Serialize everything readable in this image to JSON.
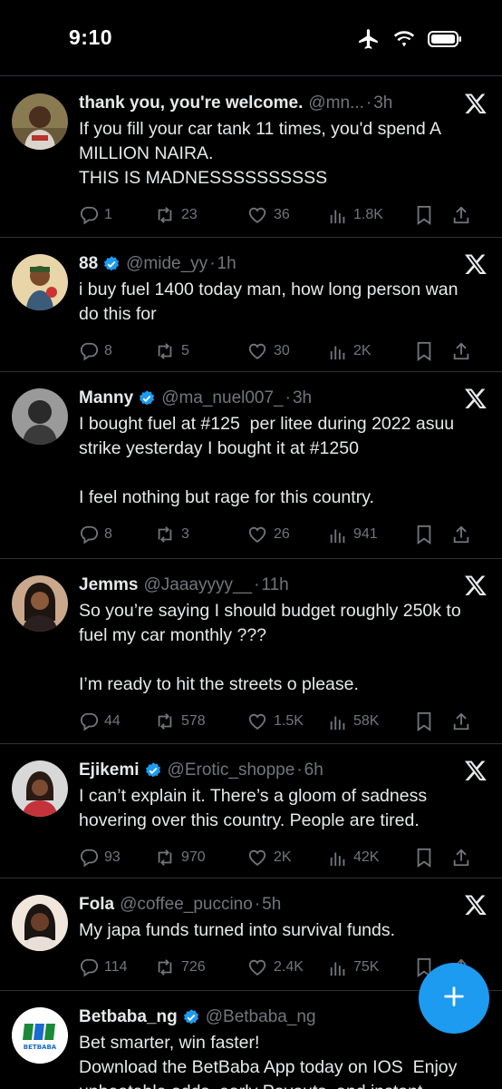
{
  "status_bar": {
    "time": "9:10",
    "icons": [
      "airplane-icon",
      "wifi-icon",
      "battery-icon"
    ]
  },
  "colors": {
    "accent": "#1d9bf0",
    "muted": "#71767b",
    "text": "#e7e9ea",
    "background": "#000000",
    "divider": "#2f3336"
  },
  "tweets": [
    {
      "name": "thank you, you're welcome.",
      "verified": false,
      "handle": "@mn...",
      "time": "3h",
      "text": "If you fill your car tank 11 times, you'd spend A MILLION NAIRA.\nTHIS IS MADNESSSSSSSSSS",
      "replies": "1",
      "retweets": "23",
      "likes": "36",
      "views": "1.8K"
    },
    {
      "name": "88",
      "verified": true,
      "handle": "@mide_yy",
      "time": "1h",
      "text": "i buy fuel 1400 today man, how long person wan do this for",
      "replies": "8",
      "retweets": "5",
      "likes": "30",
      "views": "2K"
    },
    {
      "name": "Manny",
      "verified": true,
      "handle": "@ma_nuel007_",
      "time": "3h",
      "text": "I bought fuel at #125  per litee during 2022 asuu strike yesterday I bought it at #1250\n\nI feel nothing but rage for this country.",
      "replies": "8",
      "retweets": "3",
      "likes": "26",
      "views": "941"
    },
    {
      "name": "Jemms",
      "verified": false,
      "handle": "@Jaaayyyy__",
      "time": "11h",
      "text": "So you’re saying I should budget roughly 250k to fuel my car monthly ???\n\nI’m ready to hit the streets o please.",
      "replies": "44",
      "retweets": "578",
      "likes": "1.5K",
      "views": "58K"
    },
    {
      "name": "Ejikemi",
      "verified": true,
      "handle": "@Erotic_shoppe",
      "time": "6h",
      "text": "I can’t explain it. There’s a gloom of sadness hovering over this country. People are tired.",
      "replies": "93",
      "retweets": "970",
      "likes": "2K",
      "views": "42K"
    },
    {
      "name": "Fola",
      "verified": false,
      "handle": "@coffee_puccino",
      "time": "5h",
      "text": "My japa funds turned into survival funds.",
      "replies": "114",
      "retweets": "726",
      "likes": "2.4K",
      "views": "75K"
    },
    {
      "name": "Betbaba_ng",
      "verified": true,
      "handle": "@Betbaba_ng",
      "time": "",
      "text": "Bet smarter, win faster!\nDownload the BetBaba App today on IOS  Enjoy unbeatable odds, early Payouts, and instant",
      "avatar_logo_text": "BETBABA"
    }
  ],
  "fab": {
    "icon": "plus-icon"
  }
}
